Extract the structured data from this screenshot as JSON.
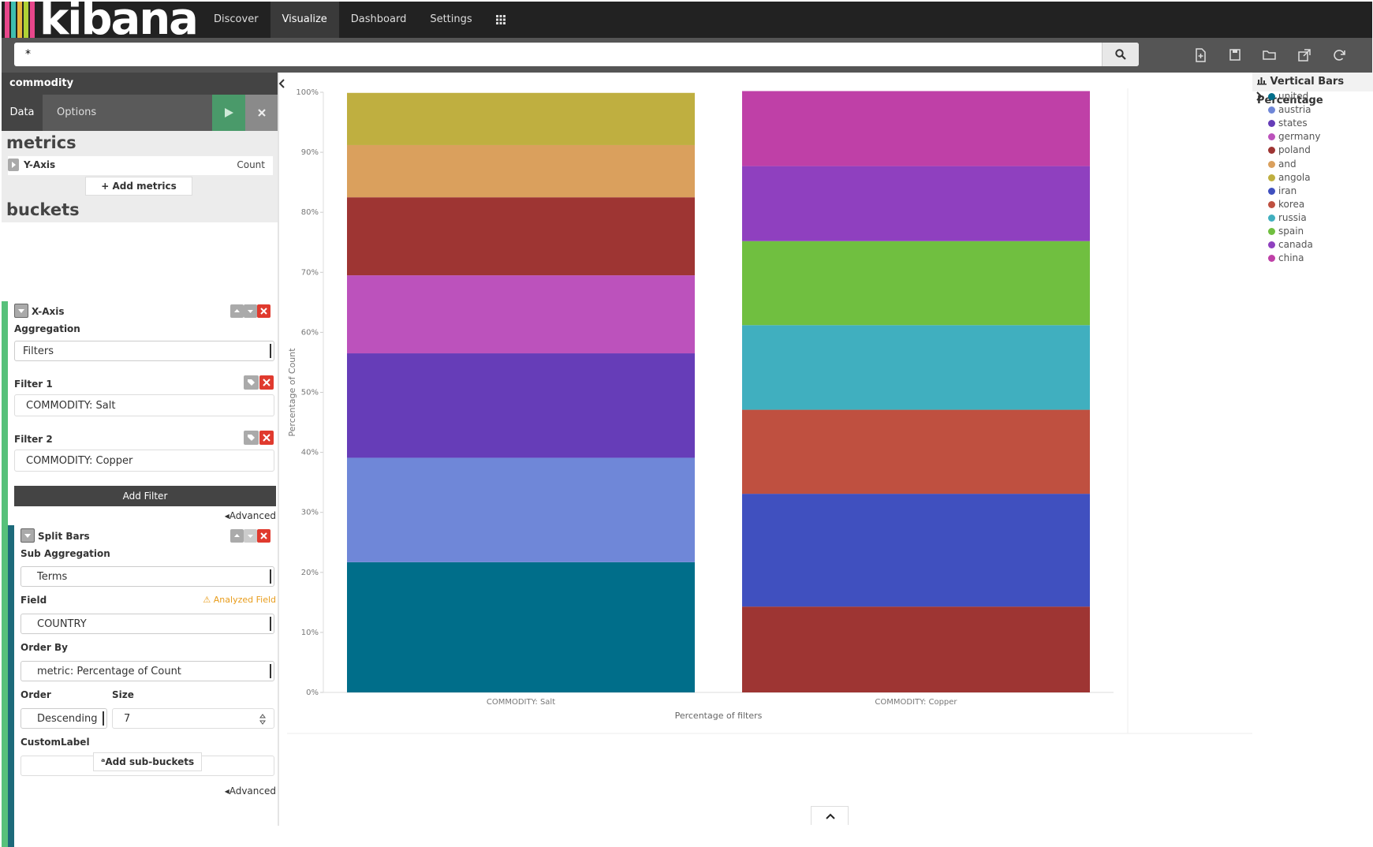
{
  "app": {
    "logo_text": "kibana",
    "stripe_colors": [
      "#e8478b",
      "#3ebeb0",
      "#e7b53c",
      "#b0d235",
      "#7a6dc9"
    ]
  },
  "nav": {
    "items": [
      "Discover",
      "Visualize",
      "Dashboard",
      "Settings"
    ],
    "active": "Visualize"
  },
  "search": {
    "value": "*"
  },
  "sidebar": {
    "index": "commodity",
    "tabs": {
      "data": "Data",
      "options": "Options"
    },
    "metrics_heading": "metrics",
    "y_axis": {
      "label": "Y-Axis",
      "value": "Count"
    },
    "add_metrics": "Add metrics",
    "buckets_heading": "buckets",
    "x_axis": {
      "label": "X-Axis",
      "aggregation_label": "Aggregation",
      "aggregation_value": "Filters",
      "filter1_label": "Filter 1",
      "filter1_value": "COMMODITY:   Salt",
      "filter2_label": "Filter 2",
      "filter2_value": "COMMODITY:   Copper",
      "add_filter": "Add Filter",
      "advanced": "Advanced"
    },
    "split_bars": {
      "label": "Split Bars",
      "sub_aggregation_label": "Sub Aggregation",
      "sub_aggregation_value": "Terms",
      "field_label": "Field",
      "field_warning": "Analyzed Field",
      "field_value": "COUNTRY",
      "order_by_label": "Order By",
      "order_by_value": "metric: Percentage of Count",
      "order_label": "Order",
      "order_value": "Descending",
      "size_label": "Size",
      "size_value": "7",
      "custom_label": "CustomLabel",
      "custom_label_value": "",
      "advanced": "Advanced"
    },
    "add_sub_buckets": "Add sub-buckets"
  },
  "legend": {
    "title": "Vertical Bars Percentage",
    "items": [
      {
        "name": "united",
        "color": "#006e8a"
      },
      {
        "name": "austria",
        "color": "#6f87d8"
      },
      {
        "name": "states",
        "color": "#663db8"
      },
      {
        "name": "germany",
        "color": "#bc52bc"
      },
      {
        "name": "poland",
        "color": "#9e3533"
      },
      {
        "name": "and",
        "color": "#daa05d"
      },
      {
        "name": "angola",
        "color": "#bfaf40"
      },
      {
        "name": "iran",
        "color": "#4050bf"
      },
      {
        "name": "korea",
        "color": "#bf5040"
      },
      {
        "name": "russia",
        "color": "#40afbf"
      },
      {
        "name": "spain",
        "color": "#70bf40"
      },
      {
        "name": "canada",
        "color": "#8f40bf"
      },
      {
        "name": "china",
        "color": "#bf40a7"
      }
    ]
  },
  "chart_data": {
    "type": "bar",
    "stacked": true,
    "categories": [
      "COMMODITY: Salt",
      "COMMODITY: Copper"
    ],
    "xlabel": "Percentage of filters",
    "ylabel": "Percentage of Count",
    "ylim": [
      0,
      100
    ],
    "yticks": [
      "0%",
      "10%",
      "20%",
      "30%",
      "40%",
      "50%",
      "60%",
      "70%",
      "80%",
      "90%",
      "100%"
    ],
    "series": [
      {
        "name": "united",
        "color": "#006e8a",
        "values": [
          21.7,
          0
        ]
      },
      {
        "name": "austria",
        "color": "#6f87d8",
        "values": [
          17.4,
          0
        ]
      },
      {
        "name": "states",
        "color": "#663db8",
        "values": [
          17.4,
          0
        ]
      },
      {
        "name": "germany",
        "color": "#bc52bc",
        "values": [
          13.0,
          0
        ]
      },
      {
        "name": "poland",
        "color": "#9e3533",
        "values": [
          13.0,
          14.3
        ]
      },
      {
        "name": "and",
        "color": "#daa05d",
        "values": [
          8.7,
          0
        ]
      },
      {
        "name": "angola",
        "color": "#bfaf40",
        "values": [
          8.7,
          0
        ]
      },
      {
        "name": "iran",
        "color": "#4050bf",
        "values": [
          0,
          18.8
        ]
      },
      {
        "name": "korea",
        "color": "#bf5040",
        "values": [
          0,
          14.0
        ]
      },
      {
        "name": "russia",
        "color": "#40afbf",
        "values": [
          0,
          14.1
        ]
      },
      {
        "name": "spain",
        "color": "#70bf40",
        "values": [
          0,
          14.0
        ]
      },
      {
        "name": "canada",
        "color": "#8f40bf",
        "values": [
          0,
          12.5
        ]
      },
      {
        "name": "china",
        "color": "#bf40a7",
        "values": [
          0,
          12.5
        ]
      }
    ]
  }
}
